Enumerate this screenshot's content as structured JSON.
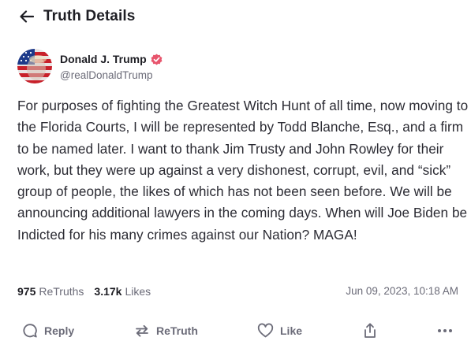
{
  "header": {
    "title": "Truth Details"
  },
  "author": {
    "display_name": "Donald J. Trump",
    "handle": "@realDonaldTrump",
    "verified": true,
    "avatar_description": "avatar"
  },
  "post": {
    "text": "For purposes of fighting the Greatest Witch Hunt of all time, now moving to the Florida Courts, I will be represented by Todd Blanche, Esq., and a firm to be named later. I want to thank Jim Trusty and John Rowley for their work, but they were up against a very dishonest, corrupt, evil, and “sick” group of people, the likes of which has not been seen before. We will be announcing additional lawyers in the coming days. When will Joe Biden be Indicted for his many crimes against our Nation? MAGA!",
    "retruths_count": "975",
    "retruths_label": "ReTruths",
    "likes_count": "3.17k",
    "likes_label": "Likes",
    "timestamp": "Jun 09, 2023, 10:18 AM"
  },
  "actions": {
    "reply": "Reply",
    "retruth": "ReTruth",
    "like": "Like"
  },
  "colors": {
    "text_primary": "#1e1e24",
    "text_secondary": "#6b6b78",
    "verified_badge": "#e8556d",
    "avatar_red": "#c8202a",
    "avatar_blue": "#1d3a8a"
  }
}
